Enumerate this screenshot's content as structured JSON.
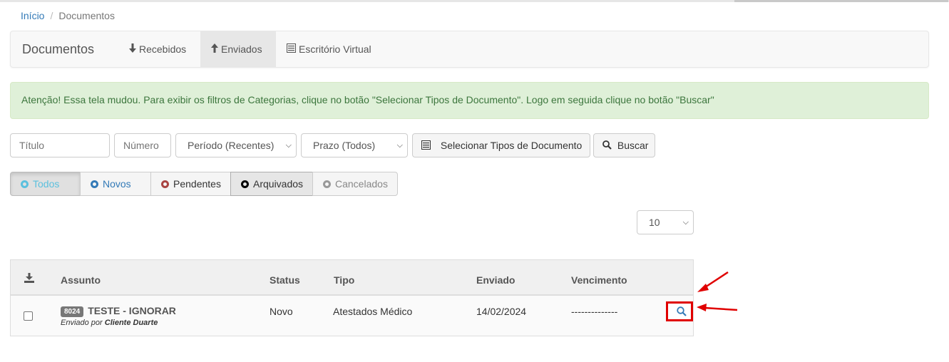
{
  "breadcrumb": {
    "home": "Início",
    "separator": "/",
    "current": "Documentos"
  },
  "navbar": {
    "brand": "Documentos",
    "items": [
      {
        "label": "Recebidos",
        "icon": "arrow-down-icon"
      },
      {
        "label": "Enviados",
        "icon": "arrow-up-icon",
        "active": true
      },
      {
        "label": "Escritório Virtual",
        "icon": "list-alt-icon"
      }
    ]
  },
  "alert": {
    "text": "Atenção! Essa tela mudou. Para exibir os filtros de Categorias, clique no botão \"Selecionar Tipos de Documento\". Logo em seguida clique no botão \"Buscar\""
  },
  "filters": {
    "title_placeholder": "Título",
    "number_placeholder": "Número",
    "period_selected": "Período (Recentes)",
    "deadline_selected": "Prazo (Todos)",
    "select_types_label": "Selecionar Tipos de Documento",
    "search_label": "Buscar"
  },
  "status_tabs": [
    {
      "label": "Todos",
      "color": "#5bc0de"
    },
    {
      "label": "Novos",
      "color": "#337ab7"
    },
    {
      "label": "Pendentes",
      "color": "#a94442"
    },
    {
      "label": "Arquivados",
      "color": "#000000"
    },
    {
      "label": "Cancelados",
      "color": "#999999"
    }
  ],
  "page_size": "10",
  "table": {
    "headers": {
      "subject": "Assunto",
      "status": "Status",
      "type": "Tipo",
      "sent": "Enviado",
      "due": "Vencimento"
    },
    "rows": [
      {
        "id": "8024",
        "subject": "TESTE - IGNORAR",
        "sent_by_prefix": "Enviado por",
        "sent_by": "Cliente Duarte",
        "status": "Novo",
        "type": "Atestados Médico",
        "sent": "14/02/2024",
        "due": "--------------"
      }
    ]
  },
  "colors": {
    "link": "#337ab7",
    "alert_bg": "#dff0d8",
    "alert_text": "#3c763d",
    "annotation": "#e00000"
  }
}
